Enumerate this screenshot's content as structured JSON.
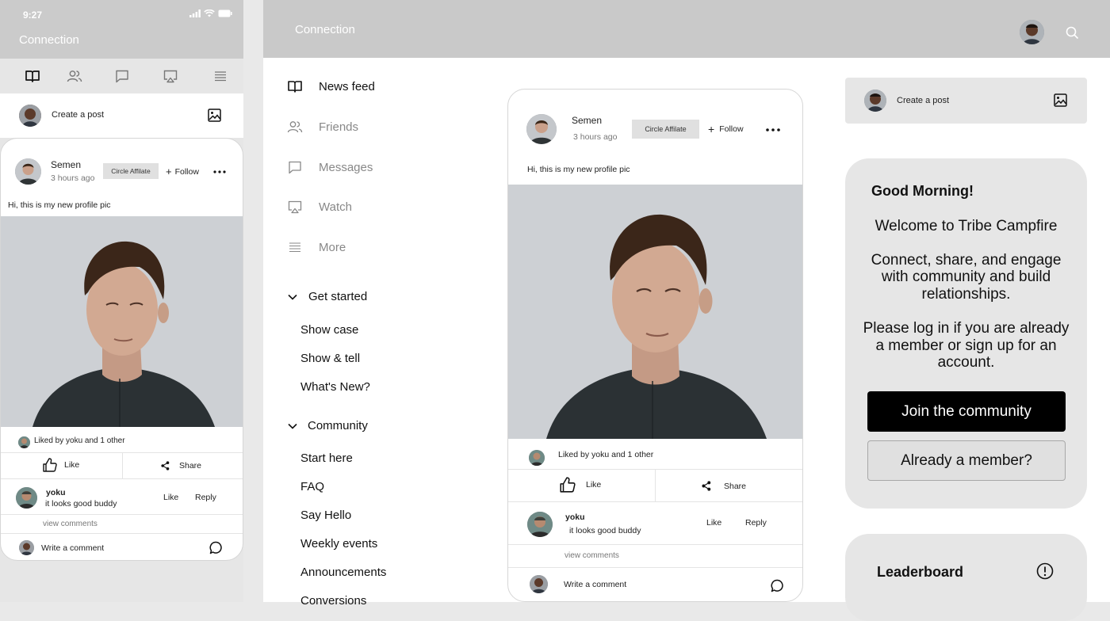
{
  "mobile": {
    "status_time": "9:27",
    "app_title": "Connection",
    "create_post_label": "Create a post",
    "post": {
      "author": "Semen",
      "time": "3 hours ago",
      "badge": "Circle Affilate",
      "follow_label": "Follow",
      "text": "Hi, this is my new profile pic",
      "liked_by": "Liked by yoku and 1 other",
      "like_label": "Like",
      "share_label": "Share",
      "comment_author": "yoku",
      "comment_text": "it looks good buddy",
      "comment_like": "Like",
      "comment_reply": "Reply",
      "view_comments": "view comments",
      "write_comment": "Write a comment"
    }
  },
  "desktop": {
    "app_title": "Connection",
    "nav": [
      {
        "label": "News feed",
        "icon": "book-icon"
      },
      {
        "label": "Friends",
        "icon": "users-icon"
      },
      {
        "label": "Messages",
        "icon": "message-icon"
      },
      {
        "label": "Watch",
        "icon": "watch-icon"
      },
      {
        "label": "More",
        "icon": "menu-icon"
      }
    ],
    "get_started": {
      "title": "Get started",
      "items": [
        "Show case",
        "Show & tell",
        "What's New?"
      ]
    },
    "community": {
      "title": "Community",
      "items": [
        "Start here",
        "FAQ",
        "Say Hello",
        "Weekly events",
        "Announcements",
        "Conversions"
      ]
    },
    "post": {
      "author": "Semen",
      "time": "3 hours ago",
      "badge": "Circle Affilate",
      "follow_label": "Follow",
      "text": "Hi, this is my new profile pic",
      "liked_by": "Liked by yoku and 1 other",
      "like_label": "Like",
      "share_label": "Share",
      "comment_author": "yoku",
      "comment_text": "it looks good buddy",
      "comment_like": "Like",
      "comment_reply": "Reply",
      "view_comments": "view comments",
      "write_comment": "Write a comment"
    },
    "right": {
      "create_post_label": "Create a post",
      "greeting": "Good Morning!",
      "welcome": "Welcome to Tribe Campfire",
      "pitch_lines": [
        "Connect, share, and engage",
        "with community and build",
        "relationships."
      ],
      "login_lines": [
        "Please log in if you are already",
        "a member or sign up for an",
        "account."
      ],
      "join_button": "Join the community",
      "member_button": "Already a member?",
      "leaderboard_title": "Leaderboard"
    }
  },
  "colors": {
    "topbar": "#c9c9c9",
    "panel": "#e6e6e6",
    "primary_button": "#000000"
  }
}
